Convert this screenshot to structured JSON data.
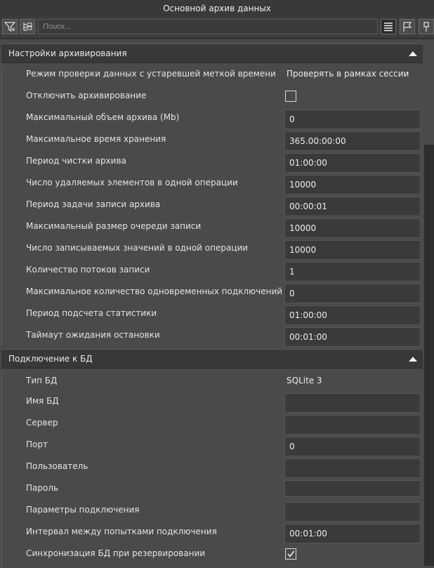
{
  "window": {
    "title": "Основной архив данных"
  },
  "toolbar": {
    "search_placeholder": "Поиск...",
    "left_icons": [
      "filter-icon",
      "hierarchy-icon"
    ],
    "right_icons": [
      "list-view-icon",
      "flag-icon",
      "pin-icon"
    ]
  },
  "sections": [
    {
      "title": "Настройки архивирования",
      "expanded": true,
      "rows": [
        {
          "label": "Режим проверки данных с устаревшей меткой времени",
          "type": "plain",
          "value": "Проверять в рамках сессии"
        },
        {
          "label": "Отключить архивирование",
          "type": "checkbox",
          "checked": false
        },
        {
          "label": "Максимальный объем архива (Mb)",
          "type": "field",
          "value": "0"
        },
        {
          "label": "Максимальное время хранения",
          "type": "field",
          "value": "365.00:00:00"
        },
        {
          "label": "Период чистки архива",
          "type": "field",
          "value": "01:00:00"
        },
        {
          "label": "Число удаляемых элементов в одной операции",
          "type": "field",
          "value": "10000"
        },
        {
          "label": "Период задачи записи архива",
          "type": "field",
          "value": "00:00:01"
        },
        {
          "label": "Максимальный размер очереди записи",
          "type": "field",
          "value": "10000"
        },
        {
          "label": "Число записываемых значений в одной операции",
          "type": "field",
          "value": "10000"
        },
        {
          "label": "Количество потоков записи",
          "type": "field",
          "value": "1"
        },
        {
          "label": "Максимальное количество одновременных подключений",
          "type": "field",
          "value": "0"
        },
        {
          "label": "Период подсчета статистики",
          "type": "field",
          "value": "01:00:00"
        },
        {
          "label": "Таймаут ожидания остановки",
          "type": "field",
          "value": "00:01:00"
        }
      ]
    },
    {
      "title": "Подключение к БД",
      "expanded": true,
      "rows": [
        {
          "label": "Тип БД",
          "type": "plain",
          "value": "SQLite 3"
        },
        {
          "label": "Имя БД",
          "type": "field",
          "value": ""
        },
        {
          "label": "Сервер",
          "type": "field",
          "value": ""
        },
        {
          "label": "Порт",
          "type": "field",
          "value": "0"
        },
        {
          "label": "Пользователь",
          "type": "field",
          "value": ""
        },
        {
          "label": "Пароль",
          "type": "field",
          "value": ""
        },
        {
          "label": "Параметры подключения",
          "type": "field",
          "value": ""
        },
        {
          "label": "Интервал между попытками подключения",
          "type": "field",
          "value": "00:01:00"
        },
        {
          "label": "Синхронизация БД при резервировании",
          "type": "checkbox",
          "checked": true
        }
      ]
    }
  ]
}
